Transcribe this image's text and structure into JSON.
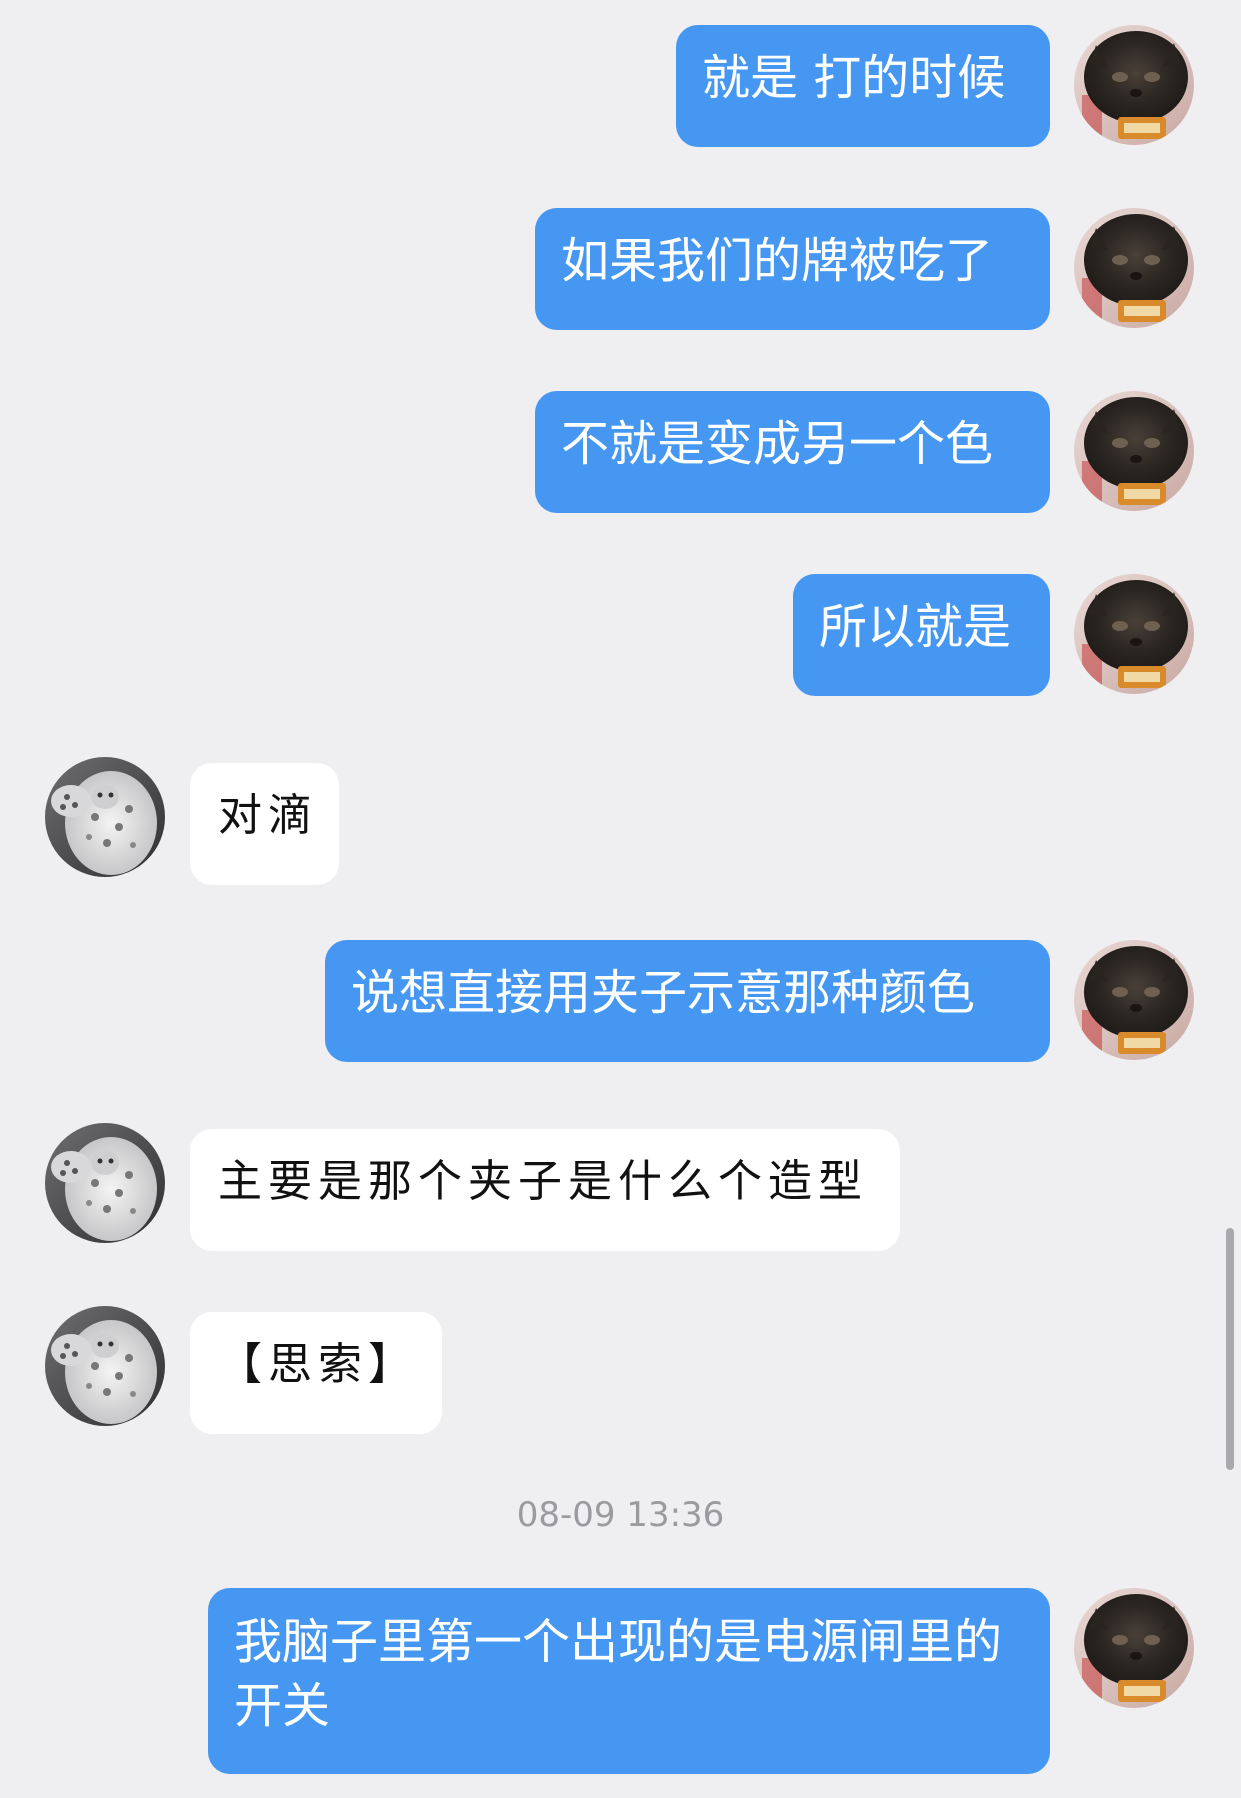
{
  "messages": [
    {
      "side": "out",
      "text": "就是 打的时候"
    },
    {
      "side": "out",
      "text": "如果我们的牌被吃了"
    },
    {
      "side": "out",
      "text": "不就是变成另一个色"
    },
    {
      "side": "out",
      "text": "所以就是"
    },
    {
      "side": "in",
      "text": "对滴"
    },
    {
      "side": "out",
      "text": "说想直接用夹子示意那种颜色"
    },
    {
      "side": "in",
      "text": "主要是那个夹子是什么个造型"
    },
    {
      "side": "in",
      "text": "【思索】"
    },
    {
      "side": "out",
      "text": " 我脑子里第一个出现的是电源闸里的开关"
    }
  ],
  "timestamp": "08-09 13:36",
  "icons": {
    "self_avatar": "cat-avatar-icon",
    "contact_avatar": "snow-leopard-avatar-icon"
  },
  "colors": {
    "background": "#efeff1",
    "outgoing_bubble": "#4597f2",
    "incoming_bubble": "#ffffff",
    "timestamp_text": "#9b9b9f"
  }
}
